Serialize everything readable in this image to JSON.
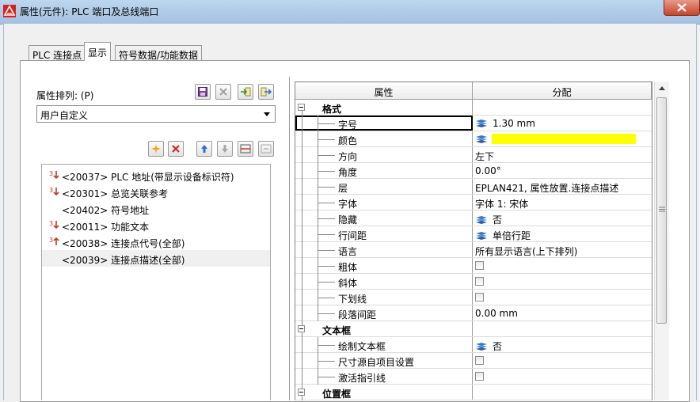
{
  "window": {
    "title": "属性(元件): PLC 端口及总线端口"
  },
  "tabs": [
    {
      "label": "PLC 连接点"
    },
    {
      "label": "显示",
      "active": true
    },
    {
      "label": "符号数据/功能数据"
    }
  ],
  "left": {
    "sort_label": "属性排列: (P)",
    "combo_value": "用户自定义",
    "toolbar_top_icons": [
      "save-icon",
      "delete-icon",
      "import-icon",
      "export-icon"
    ],
    "toolbar_list_icons": [
      "new-star-icon",
      "delete-icon",
      "move-up-icon",
      "move-down-icon",
      "split-icon",
      "merge-icon"
    ],
    "items": [
      {
        "label": "<20037> PLC 地址(带显示设备标识符)",
        "icon": "red-arrow-icon"
      },
      {
        "label": "<20301> 总览关联参考",
        "icon": "red-arrow-icon"
      },
      {
        "label": "<20402> 符号地址",
        "icon": ""
      },
      {
        "label": "<20011> 功能文本",
        "icon": "red-arrow-icon"
      },
      {
        "label": "<20038> 连接点代号(全部)",
        "icon": "red-arrow-up-icon"
      },
      {
        "label": "<20039> 连接点描述(全部)",
        "icon": "",
        "selected": true
      }
    ]
  },
  "grid": {
    "headers": [
      "属性",
      "分配"
    ],
    "rows": [
      {
        "type": "category",
        "name": "格式"
      },
      {
        "type": "prop",
        "name": "字号",
        "value": "1.30 mm",
        "layer_icon": true,
        "selected": true
      },
      {
        "type": "prop",
        "name": "颜色",
        "value": "",
        "layer_icon": true,
        "color": "#ffff00"
      },
      {
        "type": "prop",
        "name": "方向",
        "value": "左下"
      },
      {
        "type": "prop",
        "name": "角度",
        "value": "0.00°"
      },
      {
        "type": "prop",
        "name": "层",
        "value": "EPLAN421, 属性放置.连接点描述"
      },
      {
        "type": "prop",
        "name": "字体",
        "value": "字体 1: 宋体"
      },
      {
        "type": "prop",
        "name": "隐藏",
        "value": "否",
        "layer_icon": true
      },
      {
        "type": "prop",
        "name": "行间距",
        "value": "单倍行距",
        "layer_icon": true
      },
      {
        "type": "prop",
        "name": "语言",
        "value": "所有显示语言(上下排列)"
      },
      {
        "type": "prop",
        "name": "粗体",
        "checkbox": true
      },
      {
        "type": "prop",
        "name": "斜体",
        "checkbox": true
      },
      {
        "type": "prop",
        "name": "下划线",
        "checkbox": true
      },
      {
        "type": "prop",
        "name": "段落间距",
        "value": "0.00 mm"
      },
      {
        "type": "category",
        "name": "文本框"
      },
      {
        "type": "prop",
        "name": "绘制文本框",
        "value": "否",
        "layer_icon": true
      },
      {
        "type": "prop",
        "name": "尺寸源自项目设置",
        "checkbox": true
      },
      {
        "type": "prop",
        "name": "激活指引线",
        "checkbox": true
      },
      {
        "type": "category",
        "name": "位置框"
      }
    ]
  }
}
